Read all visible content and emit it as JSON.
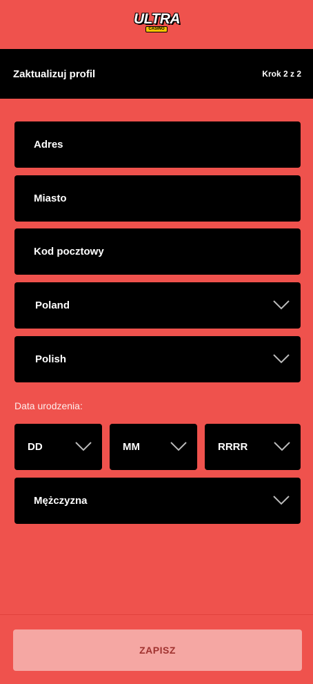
{
  "logo": {
    "main": "ULTRA",
    "sub": "CASINO"
  },
  "header": {
    "title": "Zaktualizuj profil",
    "step": "Krok 2 z 2"
  },
  "fields": {
    "address_placeholder": "Adres",
    "city_placeholder": "Miasto",
    "postcode_placeholder": "Kod pocztowy",
    "country_value": "Poland",
    "language_value": "Polish"
  },
  "dob": {
    "label": "Data urodzenia:",
    "day": "DD",
    "month": "MM",
    "year": "RRRR"
  },
  "gender_value": "Mężczyzna",
  "save_label": "ZAPISZ",
  "colors": {
    "background": "#ef524d",
    "field": "#000000",
    "button": "#f5a7a3",
    "button_text": "#a0322f",
    "logo_accent": "#f5c400"
  },
  "icons": {
    "dropdown": "chevron-down-icon"
  }
}
